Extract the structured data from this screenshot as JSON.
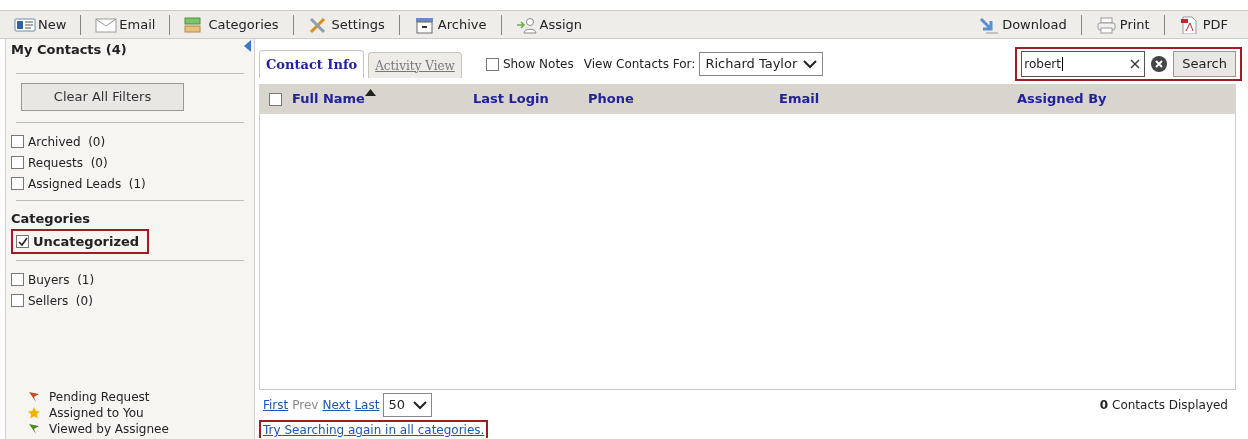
{
  "toolbar": {
    "left": [
      {
        "label": "New",
        "kind": "card"
      },
      {
        "label": "Email",
        "kind": "envelope"
      },
      {
        "label": "Categories",
        "kind": "tags"
      },
      {
        "label": "Settings",
        "kind": "tools"
      },
      {
        "label": "Archive",
        "kind": "box"
      },
      {
        "label": "Assign",
        "kind": "person"
      }
    ],
    "right": [
      {
        "label": "Download",
        "kind": "download"
      },
      {
        "label": "Print",
        "kind": "printer"
      },
      {
        "label": "PDF",
        "kind": "pdf"
      }
    ]
  },
  "sidebar": {
    "title": "My Contacts (4)",
    "clear_button": "Clear All Filters",
    "filters": [
      {
        "label": "Archived  (0)",
        "checked": false
      },
      {
        "label": "Requests  (0)",
        "checked": false
      },
      {
        "label": "Assigned Leads  (1)",
        "checked": false
      }
    ],
    "categories_heading": "Categories",
    "highlighted_category": {
      "label": "Uncategorized",
      "checked": true
    },
    "categories": [
      {
        "label": "Buyers  (1)",
        "checked": false
      },
      {
        "label": "Sellers  (0)",
        "checked": false
      }
    ],
    "legend": [
      {
        "label": "Pending Request",
        "kind": "flag",
        "color": "#c0502a"
      },
      {
        "label": "Assigned to You",
        "kind": "star",
        "color": "#f0b400"
      },
      {
        "label": "Viewed by Assignee",
        "kind": "flag",
        "color": "#4f8a2c"
      }
    ]
  },
  "tabs": [
    {
      "label": "Contact Info",
      "selected": true
    },
    {
      "label": "Activity View",
      "selected": false
    }
  ],
  "show_notes": {
    "label": "Show Notes",
    "checked": false
  },
  "view_for": {
    "label": "View Contacts For:",
    "value": "Richard Taylor"
  },
  "search": {
    "value": "robert",
    "button": "Search"
  },
  "table": {
    "columns": [
      "Full Name",
      "Last Login",
      "Phone",
      "Email",
      "Assigned By"
    ],
    "select_all": false
  },
  "pager": {
    "links": [
      {
        "label": "First",
        "disabled": false
      },
      {
        "label": "Prev",
        "disabled": true
      },
      {
        "label": "Next",
        "disabled": false
      },
      {
        "label": "Last",
        "disabled": false
      }
    ],
    "page_size": "50",
    "count": "**0** Contacts Displayed"
  },
  "retry_link": "Try Searching again in all categories."
}
